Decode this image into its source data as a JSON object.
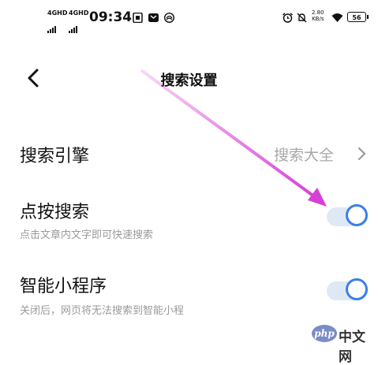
{
  "status_bar": {
    "signal1": "4GHD",
    "signal2": "4GHD",
    "time": "09:34",
    "net_speed_value": "2.80",
    "net_speed_unit": "KB/s",
    "battery": "56",
    "icons": [
      "sim-card-icon",
      "message-icon",
      "app-icon",
      "alarm-icon",
      "mute-icon",
      "wifi-icon"
    ]
  },
  "header": {
    "title": "搜索设置",
    "back_icon": "chevron-left-icon"
  },
  "settings": {
    "search_engine": {
      "label": "搜索引擎",
      "value": "搜索大全"
    },
    "tap_search": {
      "label": "点按搜索",
      "description": "点击文章内文字即可快速搜索",
      "enabled": true
    },
    "mini_program": {
      "label": "智能小程序",
      "description": "关闭后，网页将无法搜索到智能小程",
      "enabled": true
    }
  },
  "watermark": {
    "logo": "php",
    "text": "中文网"
  },
  "colors": {
    "toggle_on": "#3b7fe8",
    "arrow": "#d63fd6"
  }
}
